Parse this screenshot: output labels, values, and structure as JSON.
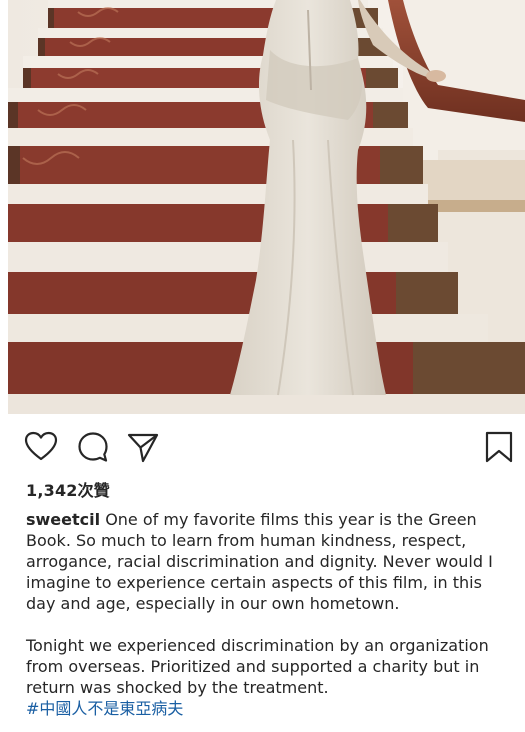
{
  "post": {
    "likes_text": "1,342次贊",
    "username": "sweetcil",
    "caption_para1": " One of my favorite films this year is the Green Book. So much to learn from human kindness, respect, arrogance, racial discrimination and dignity. Never would I imagine to experience certain aspects of this film, in this day and age, especially in our own hometown.",
    "caption_para2": "Tonight we experienced discrimination by an organization from overseas. Prioritized and supported a charity but in return was shocked by the treatment.",
    "hashtag": "#中國人不是東亞病夫"
  },
  "icons": {
    "like": "heart-icon",
    "comment": "comment-icon",
    "share": "paper-plane-icon",
    "save": "bookmark-icon"
  },
  "colors": {
    "hashtag": "#1a5fa3",
    "text": "#262626",
    "carpet": "#8b3a2e",
    "stair_marble": "#f1ebe3"
  }
}
